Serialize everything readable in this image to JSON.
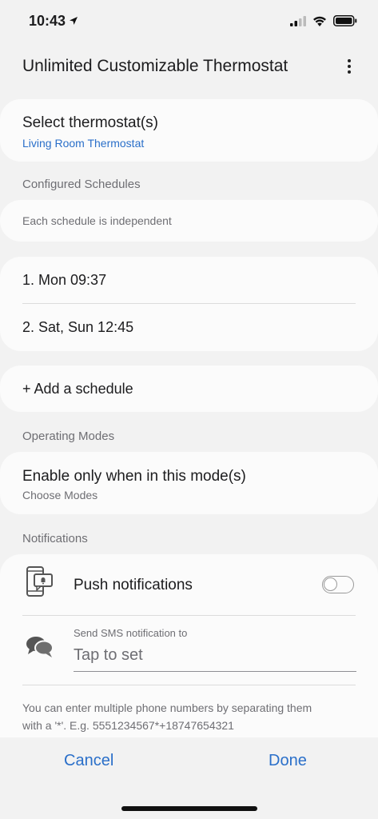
{
  "status_bar": {
    "time": "10:43"
  },
  "header": {
    "title": "Unlimited Customizable Thermostat"
  },
  "thermostat": {
    "label": "Select thermostat(s)",
    "value": "Living Room Thermostat"
  },
  "schedules": {
    "section_label": "Configured Schedules",
    "note": "Each schedule is independent",
    "items": [
      "1. Mon 09:37",
      "2. Sat, Sun 12:45"
    ],
    "add_label": "+ Add a schedule"
  },
  "modes": {
    "section_label": "Operating Modes",
    "label": "Enable only when in this mode(s)",
    "value": "Choose Modes"
  },
  "notifications": {
    "section_label": "Notifications",
    "push_label": "Push notifications",
    "push_enabled": false,
    "sms_label": "Send SMS notification to",
    "sms_placeholder": "Tap to set",
    "help_text_line1": "You can enter multiple phone numbers by separating them",
    "help_text_line2": "with a '*'. E.g. 5551234567*+18747654321"
  },
  "footer": {
    "cancel_label": "Cancel",
    "done_label": "Done"
  },
  "colors": {
    "accent": "#2a6fc9",
    "background": "#f2f2f2",
    "card": "#fbfbfb"
  }
}
